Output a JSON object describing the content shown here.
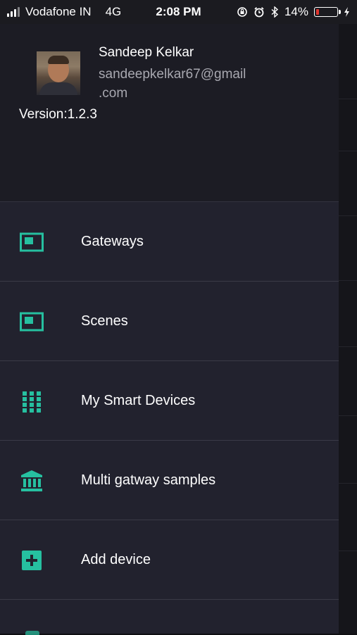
{
  "status_bar": {
    "carrier": "Vodafone IN",
    "network": "4G",
    "time": "2:08 PM",
    "battery": "14%",
    "battery_level": 0.14,
    "icons": [
      "signal-icon",
      "screen-lock-icon",
      "alarm-icon",
      "bluetooth-icon",
      "battery-icon",
      "charging-icon"
    ]
  },
  "profile": {
    "name": "Sandeep Kelkar",
    "email_line1": "sandeepkelkar67@gmail",
    "email_line2": ".com",
    "version": "Version:1.2.3"
  },
  "menu": {
    "items": [
      {
        "label": "Gateways",
        "icon": "gateway-icon"
      },
      {
        "label": "Scenes",
        "icon": "scene-icon"
      },
      {
        "label": "My Smart Devices",
        "icon": "grid-icon"
      },
      {
        "label": "Multi gatway samples",
        "icon": "bank-icon"
      },
      {
        "label": "Add device",
        "icon": "add-box-icon"
      }
    ]
  },
  "colors": {
    "accent": "#26c0a0",
    "drawer_bg": "#22222e",
    "header_bg": "#1c1c24",
    "battery_low": "#e0342e"
  }
}
